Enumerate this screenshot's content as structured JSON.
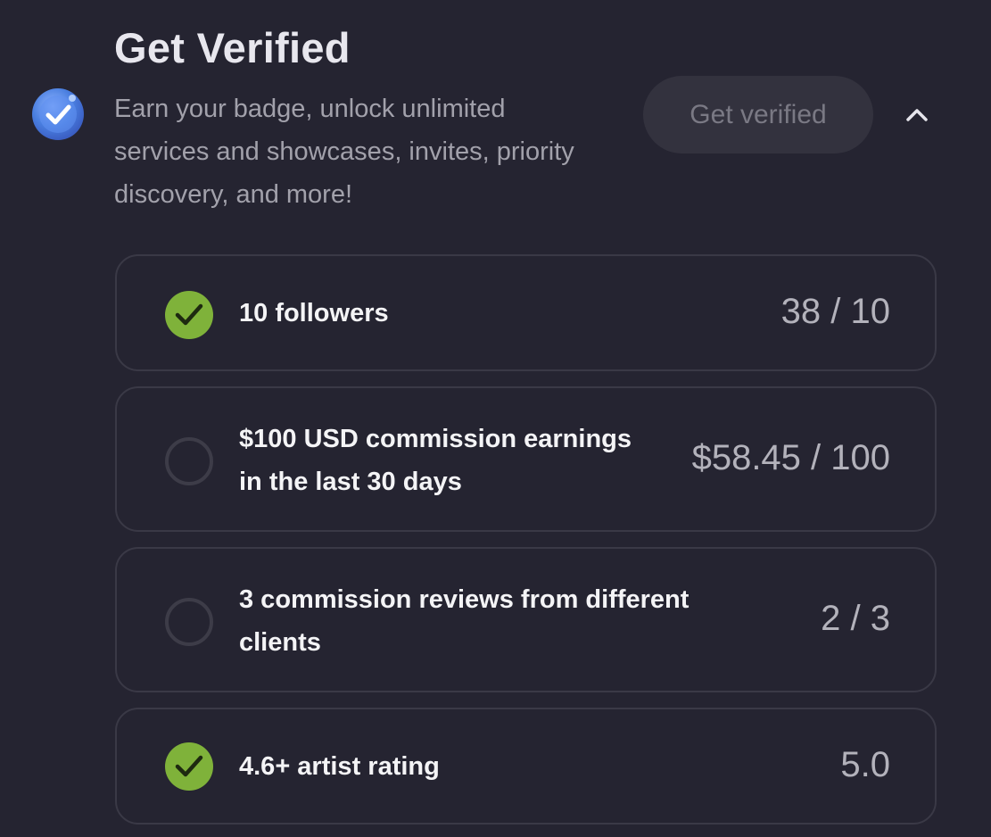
{
  "header": {
    "title": "Get Verified",
    "subtitle": "Earn your badge, unlock unlimited services and showcases, invites, priority discovery, and more!",
    "button_label": "Get verified"
  },
  "colors": {
    "background": "#252431",
    "done_green": "#7fb23a",
    "badge_blue": "#4a7fe0"
  },
  "requirements": [
    {
      "label": "10 followers",
      "value": "38 / 10",
      "completed": true
    },
    {
      "label": "$100 USD commission earnings in the last 30 days",
      "value": "$58.45 / 100",
      "completed": false
    },
    {
      "label": "3 commission reviews from different clients",
      "value": "2 / 3",
      "completed": false
    },
    {
      "label": "4.6+ artist rating",
      "value": "5.0",
      "completed": true
    }
  ]
}
